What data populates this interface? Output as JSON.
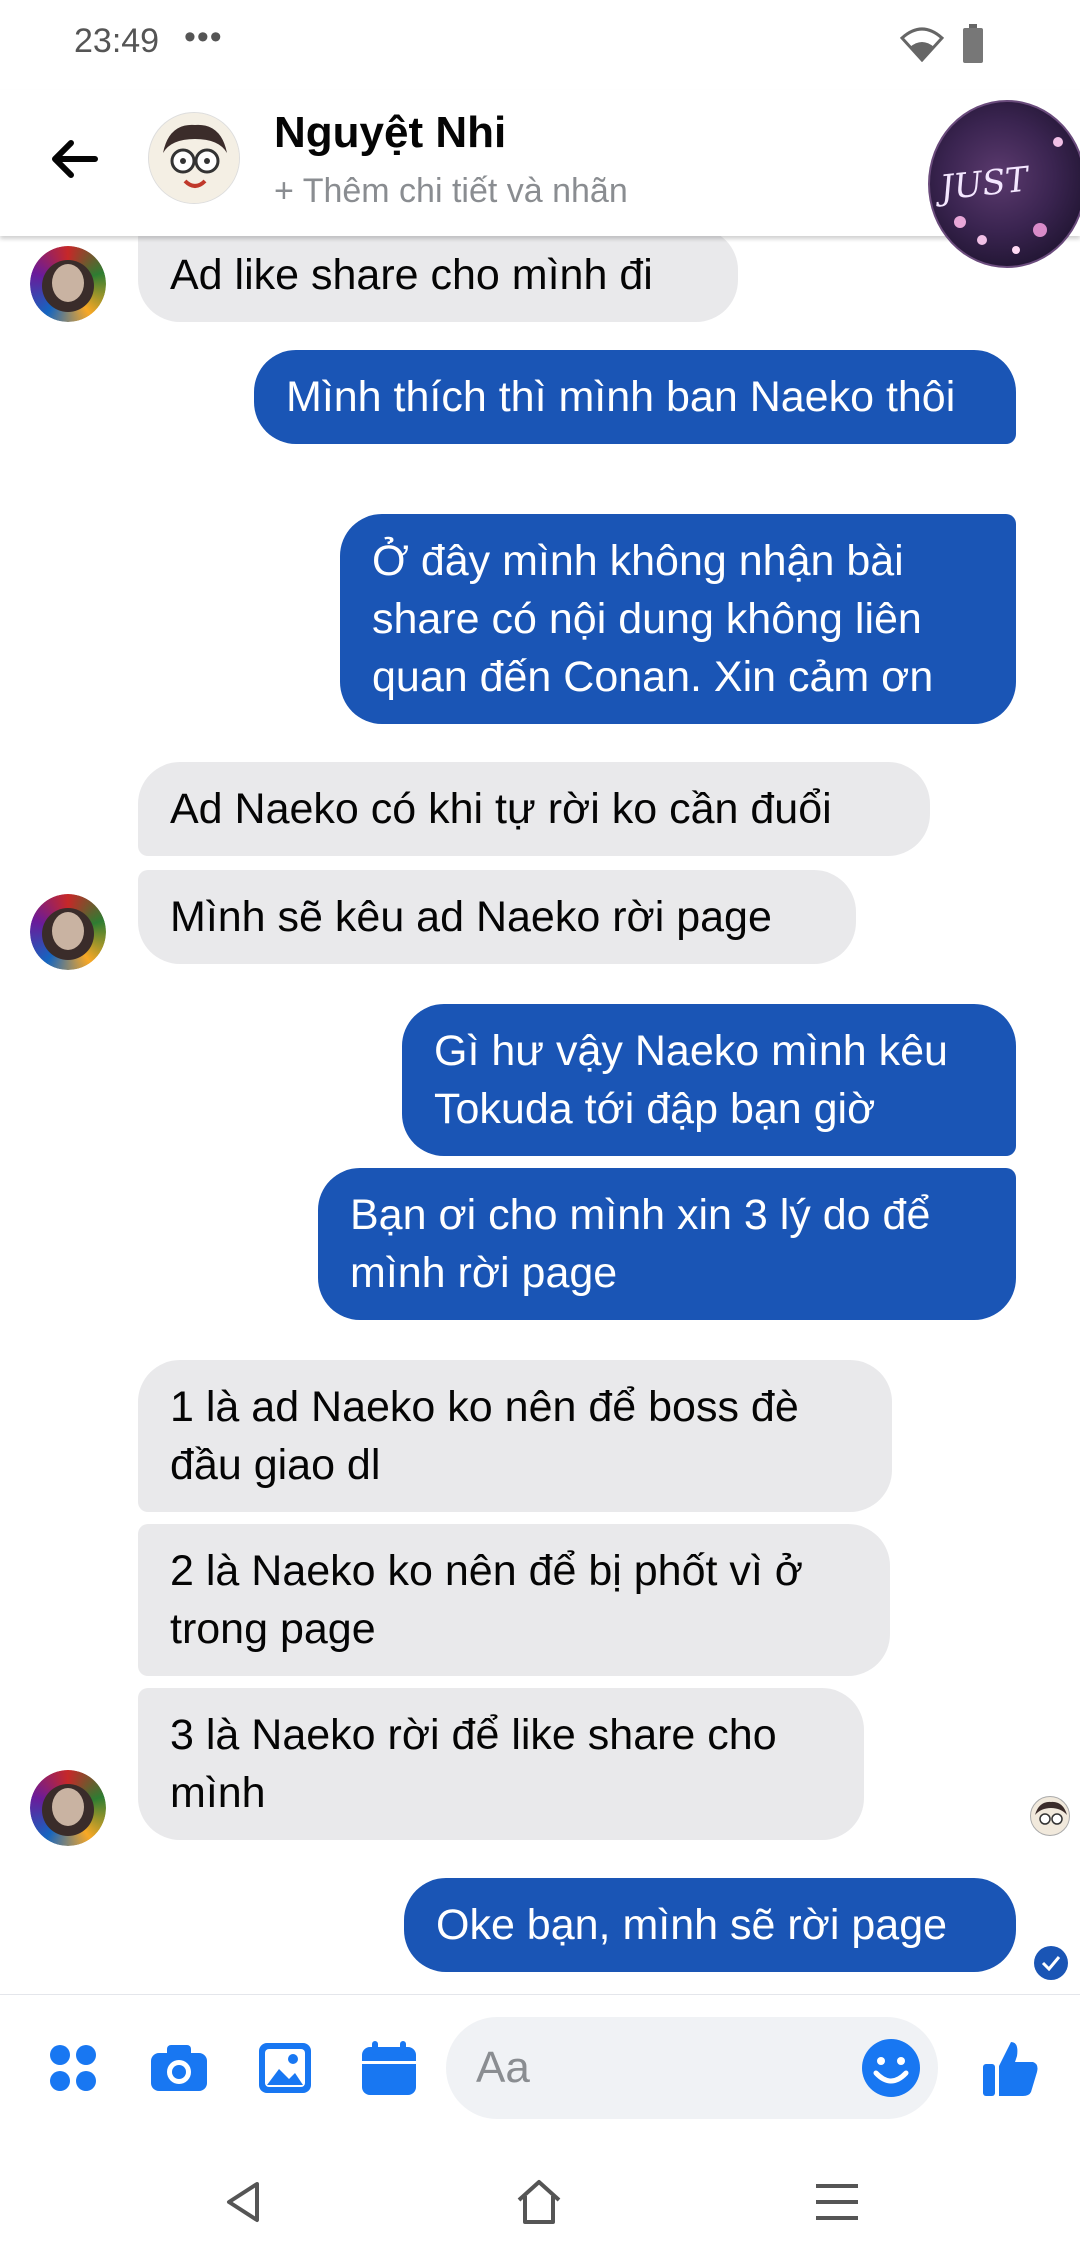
{
  "status_bar": {
    "time": "23:49",
    "dots": "•••",
    "battery": "battery-icon",
    "wifi": "wifi-icon"
  },
  "header": {
    "name": "Nguyệt Nhi",
    "subtitle": "+ Thêm chi tiết và nhãn",
    "chat_head_text": "JUST"
  },
  "messages": [
    {
      "from": "them",
      "text": "Ad like share cho mình đi"
    },
    {
      "from": "me",
      "text": "Mình thích thì mình ban Naeko thôi"
    },
    {
      "from": "me",
      "text": "Ở đây mình không nhận bài share có nội dung không liên quan đến Conan. Xin cảm ơn"
    },
    {
      "from": "them",
      "text": "Ad Naeko có khi tự rời ko cần đuổi"
    },
    {
      "from": "them",
      "text": "Mình sẽ kêu ad Naeko rời page"
    },
    {
      "from": "me",
      "text": "Gì hư vậy Naeko mình kêu Tokuda tới đập bạn giờ"
    },
    {
      "from": "me",
      "text": "Bạn ơi cho mình xin 3 lý do để mình rời page"
    },
    {
      "from": "them",
      "text": "1 là ad Naeko ko nên để boss đè đầu giao dl"
    },
    {
      "from": "them",
      "text": "2 là Naeko ko nên để bị phốt vì ở trong page"
    },
    {
      "from": "them",
      "text": "3 là Naeko rời để like share cho mình"
    },
    {
      "from": "me",
      "text": "Oke bạn, mình sẽ rời page"
    }
  ],
  "composer": {
    "placeholder": "Aa",
    "icons": [
      "menu-grid-icon",
      "camera-icon",
      "image-icon",
      "calendar-icon",
      "emoji-icon",
      "like-thumb-icon"
    ]
  },
  "nav": [
    "back-triangle-icon",
    "home-icon",
    "menu-lines-icon"
  ],
  "colors": {
    "outgoing": "#1a55b5",
    "incoming": "#e9e9eb",
    "accent": "#1877f2"
  }
}
